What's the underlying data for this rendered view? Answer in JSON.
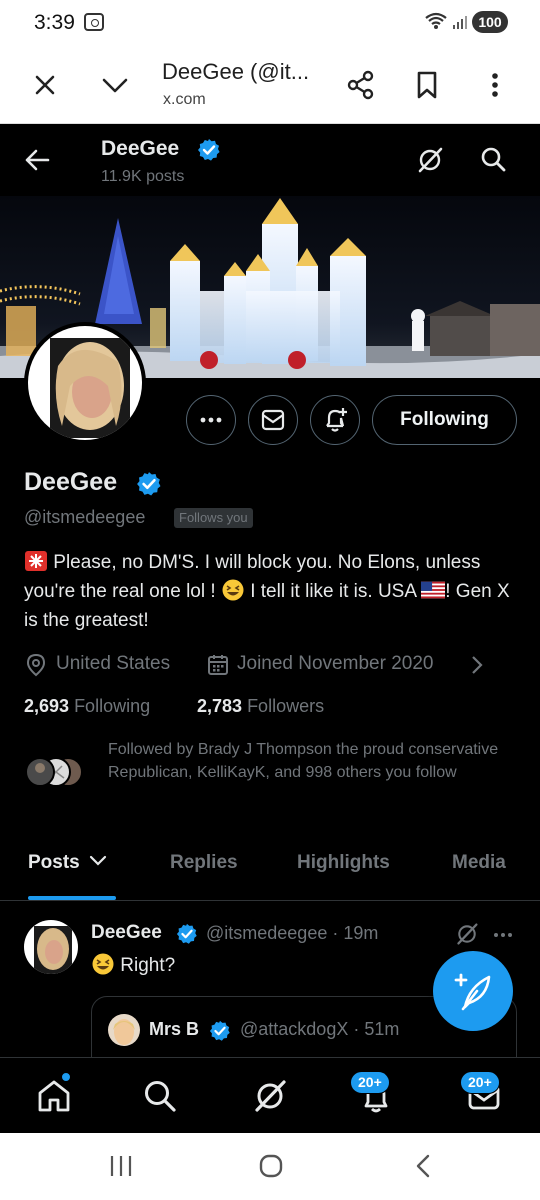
{
  "status_bar": {
    "time": "3:39",
    "battery": "100"
  },
  "browser": {
    "page_title": "DeeGee (@it...",
    "url": "x.com"
  },
  "header": {
    "name": "DeeGee",
    "post_count": "11.9K posts"
  },
  "profile": {
    "name": "DeeGee",
    "handle": "@itsmedeegee",
    "follows_you": "Follows you",
    "follow_button": "Following",
    "bio_part1": " Please, no DM'S. I will block you. No Elons, unless you're the real one lol ! ",
    "bio_part2": "  I tell it like it is. USA ",
    "bio_part3": "!   Gen X is the greatest!",
    "location": "United States",
    "joined": "Joined November 2020",
    "following_count": "2,693",
    "following_label": "Following",
    "followers_count": "2,783",
    "followers_label": "Followers",
    "followed_by": "Followed by Brady J Thompson the proud conservative Republican, KelliKayK, and 998 others you follow"
  },
  "tabs": [
    {
      "label": "Posts",
      "active": true
    },
    {
      "label": "Replies",
      "active": false
    },
    {
      "label": "Highlights",
      "active": false
    },
    {
      "label": "Media",
      "active": false
    }
  ],
  "post": {
    "name": "DeeGee",
    "meta": "@itsmedeegee · 19m",
    "text": "Right?",
    "quote": {
      "name": "Mrs B",
      "meta": "@attackdogX · 51m"
    }
  },
  "bottom_nav": {
    "notifications_badge": "20+",
    "messages_badge": "20+"
  },
  "colors": {
    "accent": "#1d9bf0",
    "background": "#000000",
    "muted_text": "#71767b",
    "primary_text": "#e7e9ea"
  },
  "icons": [
    "close-icon",
    "chevron-down-icon",
    "share-icon",
    "bookmark-icon",
    "more-vert-icon",
    "back-arrow-icon",
    "grok-icon",
    "search-icon",
    "more-icon",
    "mail-icon",
    "bell-plus-icon",
    "verified-badge-icon",
    "location-icon",
    "calendar-icon",
    "home-icon",
    "bell-icon",
    "envelope-icon",
    "compose-icon"
  ]
}
